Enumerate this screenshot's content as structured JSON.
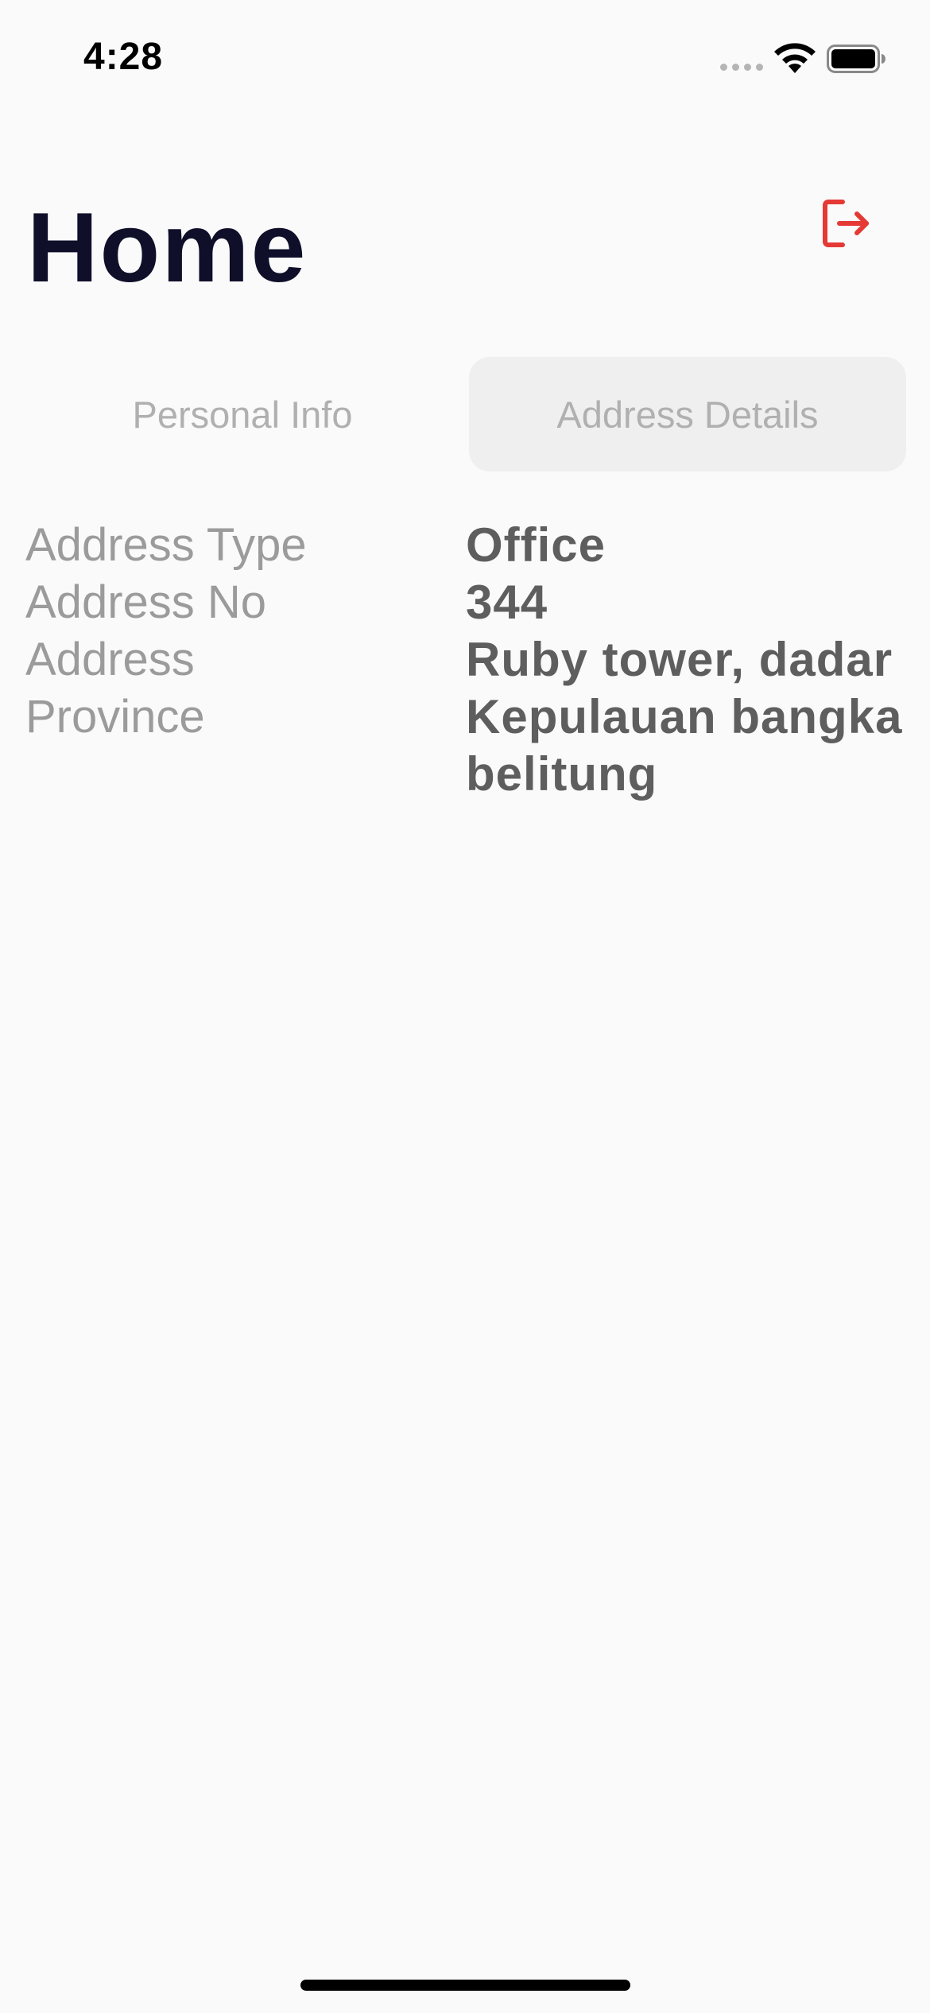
{
  "status_bar": {
    "time": "4:28"
  },
  "header": {
    "title": "Home",
    "logout_icon": "logout-arrow-icon",
    "logout_color": "#e53935"
  },
  "tabs": [
    {
      "label": "Personal Info",
      "active": false
    },
    {
      "label": "Address Details",
      "active": true
    }
  ],
  "details": [
    {
      "label": "Address Type",
      "value": "Office"
    },
    {
      "label": "Address No",
      "value": "344"
    },
    {
      "label": "Address",
      "value": "Ruby tower, dadar"
    },
    {
      "label": "Province",
      "value": "Kepulauan bangka belitung"
    }
  ],
  "colors": {
    "background": "#fafafa",
    "title": "#0f0f2a",
    "label": "#9b9b9b",
    "value": "#5e5e5e",
    "active_tab_bg": "#efefef"
  }
}
